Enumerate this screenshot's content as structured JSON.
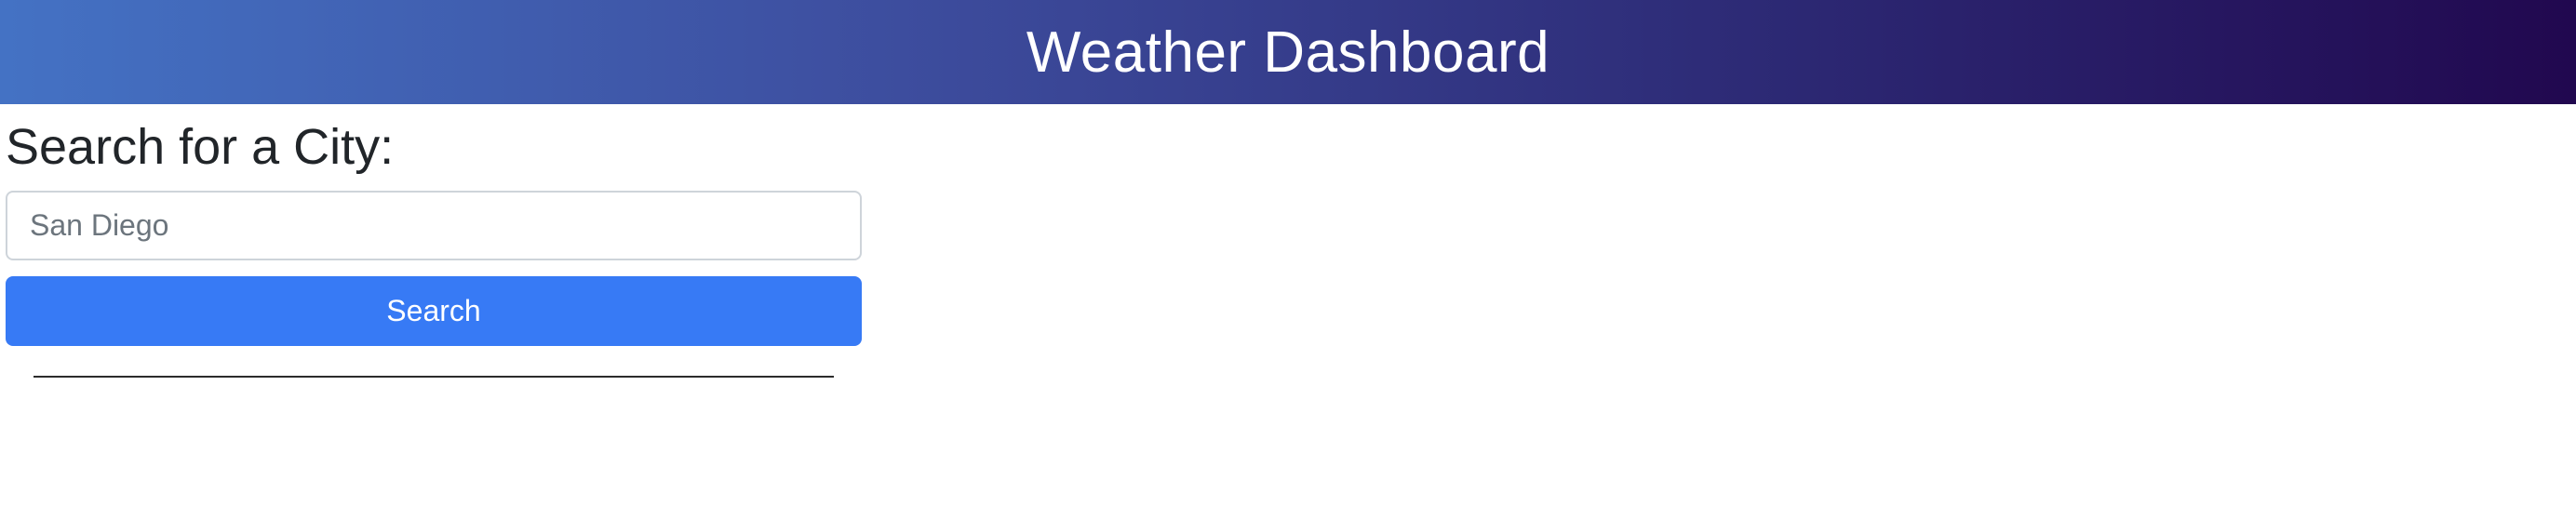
{
  "header": {
    "title": "Weather Dashboard"
  },
  "search": {
    "heading": "Search for a City:",
    "input_value": "San Diego",
    "placeholder": "San Diego",
    "button_label": "Search"
  },
  "colors": {
    "header_gradient_start": "#4472c4",
    "header_gradient_end": "#21084f",
    "button_primary": "#377af5",
    "heading_text": "#212529"
  }
}
